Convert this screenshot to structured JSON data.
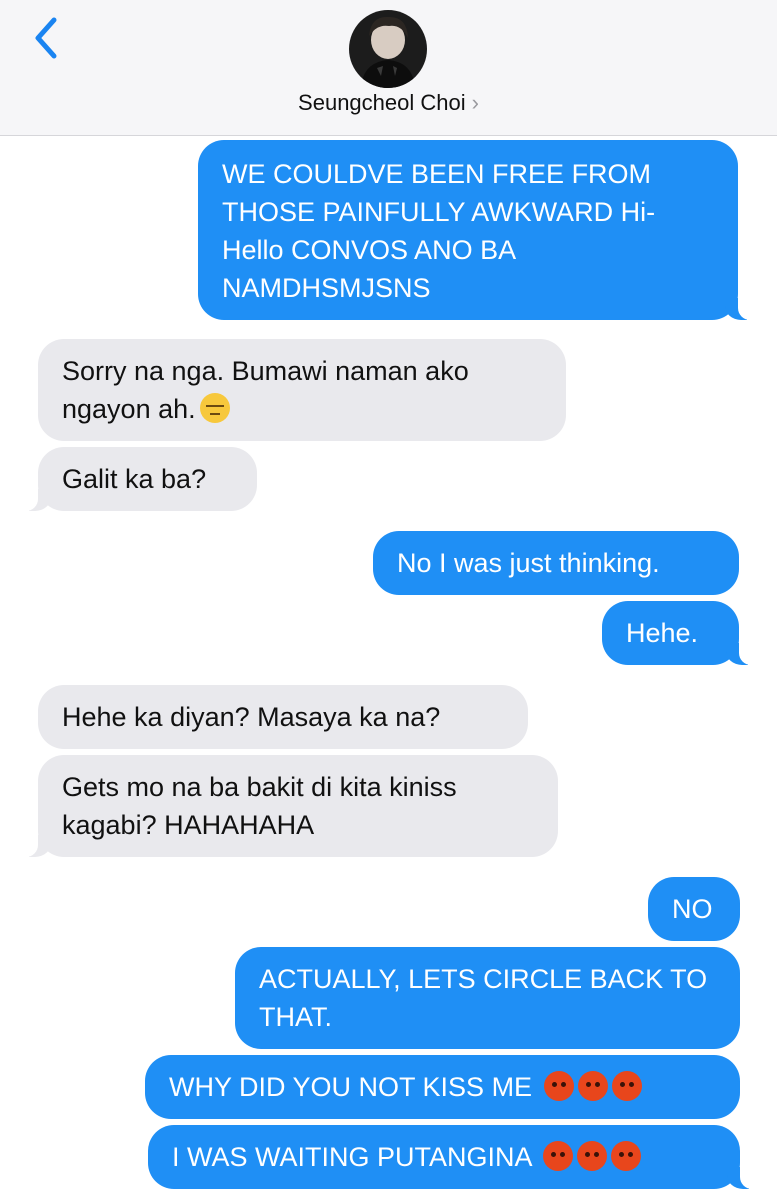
{
  "header": {
    "contact_name": "Seungcheol Choi",
    "chevron": "›",
    "back_icon": "chevron-left-icon",
    "avatar": "contact-avatar"
  },
  "colors": {
    "outgoing_bubble": "#1f8ff5",
    "incoming_bubble": "#e9e9ed",
    "accent": "#1a84f1"
  },
  "messages": [
    {
      "from": "me",
      "text": "WE COULDVE BEEN FREE FROM THOSE PAINFULLY AWKWARD Hi-Hello CONVOS ANO BA NAMDHSMJSNS"
    },
    {
      "from": "them",
      "text": "Sorry na nga. Bumawi naman ako ngayon ah.",
      "emoji": "pensive-face"
    },
    {
      "from": "them",
      "text": "Galit ka ba?"
    },
    {
      "from": "me",
      "text": "No I was just thinking."
    },
    {
      "from": "me",
      "text": "Hehe."
    },
    {
      "from": "them",
      "text": "Hehe ka diyan? Masaya ka na?"
    },
    {
      "from": "them",
      "text": "Gets mo na ba bakit di kita kiniss kagabi? HAHAHAHA"
    },
    {
      "from": "me",
      "text": "NO"
    },
    {
      "from": "me",
      "text": "ACTUALLY, LETS CIRCLE BACK TO THAT."
    },
    {
      "from": "me",
      "text": "WHY DID YOU NOT KISS ME",
      "emoji": "angry-face x3"
    },
    {
      "from": "me",
      "text": "I WAS WAITING PUTANGINA",
      "emoji": "angry-face x3"
    }
  ]
}
